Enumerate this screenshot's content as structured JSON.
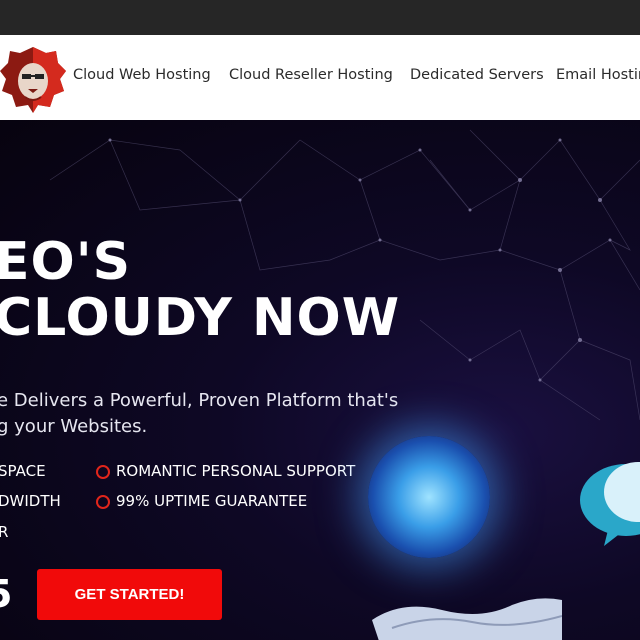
{
  "nav": {
    "links": [
      "Cloud Web Hosting",
      "Cloud Reseller Hosting",
      "Dedicated Servers",
      "Email Hosting"
    ]
  },
  "hero": {
    "headline_line1": "EO'S",
    "headline_line2": "CLOUDY NOW",
    "subtitle_line1": "e Delivers a Powerful, Proven Platform that's",
    "subtitle_line2": "g your Websites.",
    "features_left": [
      "SPACE",
      "DWIDTH",
      "R"
    ],
    "features_right": [
      "ROMANTIC PERSONAL SUPPORT",
      "99% UPTIME GUARANTEE"
    ],
    "price_fragment": "5",
    "cta_label": "GET STARTED!"
  },
  "colors": {
    "accent": "#f10a0a",
    "bullet": "#e1251b",
    "topbar": "#262626",
    "hero_bg": "#0b0618"
  },
  "icons": {
    "logo": "lion-head-logo",
    "globe": "glowing-network-globe",
    "cloud": "chat-cloud-icon"
  }
}
